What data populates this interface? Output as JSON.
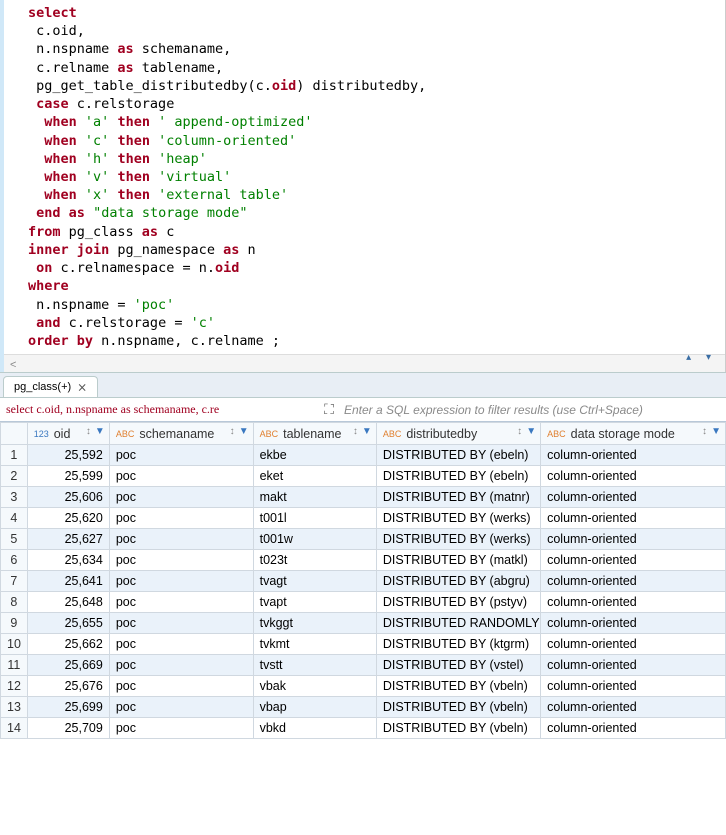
{
  "sql": {
    "lines": [
      [
        [
          "kw",
          "select"
        ]
      ],
      [
        [
          "id",
          " c.oid,"
        ]
      ],
      [
        [
          "id",
          " n.nspname "
        ],
        [
          "kw",
          "as"
        ],
        [
          "id",
          " schemaname,"
        ]
      ],
      [
        [
          "id",
          " c.relname "
        ],
        [
          "kw",
          "as"
        ],
        [
          "id",
          " tablename,"
        ]
      ],
      [
        [
          "id",
          " pg_get_table_distributedby(c."
        ],
        [
          "kw",
          "oid"
        ],
        [
          "id",
          ") distributedby,"
        ]
      ],
      [
        [
          "id",
          " "
        ],
        [
          "kw",
          "case"
        ],
        [
          "id",
          " c.relstorage"
        ]
      ],
      [
        [
          "id",
          "  "
        ],
        [
          "kw",
          "when"
        ],
        [
          "id",
          " "
        ],
        [
          "str",
          "'a'"
        ],
        [
          "id",
          " "
        ],
        [
          "kw",
          "then"
        ],
        [
          "id",
          " "
        ],
        [
          "str",
          "' append-optimized'"
        ]
      ],
      [
        [
          "id",
          "  "
        ],
        [
          "kw",
          "when"
        ],
        [
          "id",
          " "
        ],
        [
          "str",
          "'c'"
        ],
        [
          "id",
          " "
        ],
        [
          "kw",
          "then"
        ],
        [
          "id",
          " "
        ],
        [
          "str",
          "'column-oriented'"
        ]
      ],
      [
        [
          "id",
          "  "
        ],
        [
          "kw",
          "when"
        ],
        [
          "id",
          " "
        ],
        [
          "str",
          "'h'"
        ],
        [
          "id",
          " "
        ],
        [
          "kw",
          "then"
        ],
        [
          "id",
          " "
        ],
        [
          "str",
          "'heap'"
        ]
      ],
      [
        [
          "id",
          "  "
        ],
        [
          "kw",
          "when"
        ],
        [
          "id",
          " "
        ],
        [
          "str",
          "'v'"
        ],
        [
          "id",
          " "
        ],
        [
          "kw",
          "then"
        ],
        [
          "id",
          " "
        ],
        [
          "str",
          "'virtual'"
        ]
      ],
      [
        [
          "id",
          "  "
        ],
        [
          "kw",
          "when"
        ],
        [
          "id",
          " "
        ],
        [
          "str",
          "'x'"
        ],
        [
          "id",
          " "
        ],
        [
          "kw",
          "then"
        ],
        [
          "id",
          " "
        ],
        [
          "str",
          "'external table'"
        ]
      ],
      [
        [
          "id",
          " "
        ],
        [
          "kw",
          "end"
        ],
        [
          "id",
          " "
        ],
        [
          "kw",
          "as"
        ],
        [
          "id",
          " "
        ],
        [
          "dq",
          "\"data storage mode\""
        ]
      ],
      [
        [
          "kw",
          "from"
        ],
        [
          "id",
          " pg_class "
        ],
        [
          "kw",
          "as"
        ],
        [
          "id",
          " c"
        ]
      ],
      [
        [
          "kw",
          "inner join"
        ],
        [
          "id",
          " pg_namespace "
        ],
        [
          "kw",
          "as"
        ],
        [
          "id",
          " n"
        ]
      ],
      [
        [
          "id",
          " "
        ],
        [
          "kw",
          "on"
        ],
        [
          "id",
          " c.relnamespace = n."
        ],
        [
          "kw",
          "oid"
        ]
      ],
      [
        [
          "kw",
          "where"
        ]
      ],
      [
        [
          "id",
          " n.nspname = "
        ],
        [
          "str",
          "'poc'"
        ]
      ],
      [
        [
          "id",
          " "
        ],
        [
          "kw",
          "and"
        ],
        [
          "id",
          " c.relstorage = "
        ],
        [
          "str",
          "'c'"
        ]
      ],
      [
        [
          "kw",
          "order by"
        ],
        [
          "id",
          " n.nspname, c.relname ;"
        ]
      ]
    ]
  },
  "tab": {
    "label": "pg_class(+)"
  },
  "filter": {
    "expr": "select c.oid, n.nspname as schemaname, c.re",
    "placeholder": "Enter a SQL expression to filter results (use Ctrl+Space)"
  },
  "columns": [
    {
      "name": "oid",
      "dtype": "123",
      "dtypeClass": "num"
    },
    {
      "name": "schemaname",
      "dtype": "ABC",
      "dtypeClass": ""
    },
    {
      "name": "tablename",
      "dtype": "ABC",
      "dtypeClass": ""
    },
    {
      "name": "distributedby",
      "dtype": "ABC",
      "dtypeClass": ""
    },
    {
      "name": "data storage mode",
      "dtype": "ABC",
      "dtypeClass": ""
    }
  ],
  "rows": [
    {
      "n": 1,
      "oid": "25,592",
      "schema": "poc",
      "table": "ekbe",
      "dist": "DISTRIBUTED BY (ebeln)",
      "mode": "column-oriented"
    },
    {
      "n": 2,
      "oid": "25,599",
      "schema": "poc",
      "table": "eket",
      "dist": "DISTRIBUTED BY (ebeln)",
      "mode": "column-oriented"
    },
    {
      "n": 3,
      "oid": "25,606",
      "schema": "poc",
      "table": "makt",
      "dist": "DISTRIBUTED BY (matnr)",
      "mode": "column-oriented"
    },
    {
      "n": 4,
      "oid": "25,620",
      "schema": "poc",
      "table": "t001l",
      "dist": "DISTRIBUTED BY (werks)",
      "mode": "column-oriented"
    },
    {
      "n": 5,
      "oid": "25,627",
      "schema": "poc",
      "table": "t001w",
      "dist": "DISTRIBUTED BY (werks)",
      "mode": "column-oriented"
    },
    {
      "n": 6,
      "oid": "25,634",
      "schema": "poc",
      "table": "t023t",
      "dist": "DISTRIBUTED BY (matkl)",
      "mode": "column-oriented"
    },
    {
      "n": 7,
      "oid": "25,641",
      "schema": "poc",
      "table": "tvagt",
      "dist": "DISTRIBUTED BY (abgru)",
      "mode": "column-oriented"
    },
    {
      "n": 8,
      "oid": "25,648",
      "schema": "poc",
      "table": "tvapt",
      "dist": "DISTRIBUTED BY (pstyv)",
      "mode": "column-oriented"
    },
    {
      "n": 9,
      "oid": "25,655",
      "schema": "poc",
      "table": "tvkggt",
      "dist": "DISTRIBUTED RANDOMLY",
      "mode": "column-oriented"
    },
    {
      "n": 10,
      "oid": "25,662",
      "schema": "poc",
      "table": "tvkmt",
      "dist": "DISTRIBUTED BY (ktgrm)",
      "mode": "column-oriented"
    },
    {
      "n": 11,
      "oid": "25,669",
      "schema": "poc",
      "table": "tvstt",
      "dist": "DISTRIBUTED BY (vstel)",
      "mode": "column-oriented"
    },
    {
      "n": 12,
      "oid": "25,676",
      "schema": "poc",
      "table": "vbak",
      "dist": "DISTRIBUTED BY (vbeln)",
      "mode": "column-oriented"
    },
    {
      "n": 13,
      "oid": "25,699",
      "schema": "poc",
      "table": "vbap",
      "dist": "DISTRIBUTED BY (vbeln)",
      "mode": "column-oriented"
    },
    {
      "n": 14,
      "oid": "25,709",
      "schema": "poc",
      "table": "vbkd",
      "dist": "DISTRIBUTED BY (vbeln)",
      "mode": "column-oriented"
    }
  ]
}
